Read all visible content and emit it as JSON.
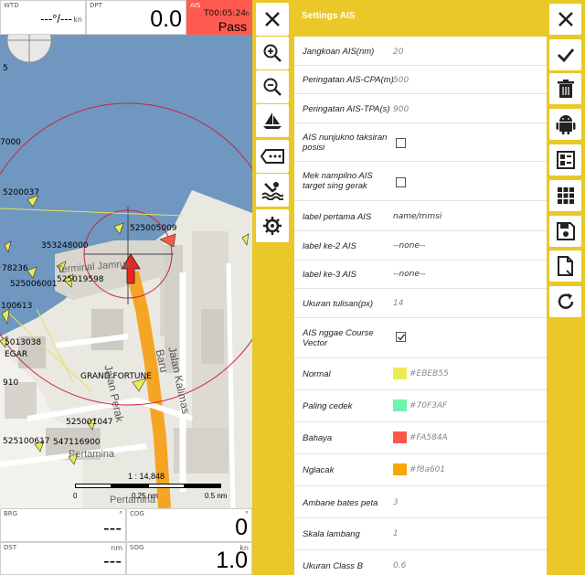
{
  "left": {
    "top_boxes": {
      "wtd": {
        "label": "WTD",
        "value": "---°/---",
        "unit": "kn"
      },
      "dpt": {
        "label": "DPT",
        "value": "0.0"
      },
      "ais": {
        "label": "AIS",
        "time": "T00:05:24",
        "time_unit": "h",
        "status": "Pass",
        "bg": "#ff5a4f"
      }
    },
    "bottom_boxes": {
      "brg": {
        "label": "BRG",
        "value": "---",
        "unit": "°"
      },
      "cog": {
        "label": "COG",
        "value": "0",
        "unit": "°"
      },
      "dst": {
        "label": "DST",
        "value": "---",
        "unit": "nm"
      },
      "sog": {
        "label": "SOG",
        "value": "1.0",
        "unit": "kn"
      }
    },
    "map": {
      "ship_labels": [
        "5",
        "7000",
        "5200037",
        "525005009",
        "353248000",
        "78236",
        "525006001",
        "525019598",
        "100613",
        "5013038",
        "EGAR",
        "910",
        "GRAND FORTUNE",
        "525001047",
        "525100617",
        "547116900"
      ],
      "place_labels": [
        "Terminal Jamrud",
        "Jalan Perak",
        "Jalan Kalimas Baru",
        "Pertamina",
        "Pertamina"
      ],
      "scale": {
        "ratio": "1 : 14,848",
        "ticks": [
          "0",
          "0.25 nm",
          "0.5 nm"
        ]
      }
    },
    "toolbar": [
      "close-icon",
      "zoom-in-icon",
      "zoom-out-icon",
      "sailboat-icon",
      "ais-tag-icon",
      "man-overboard-icon",
      "settings-icon"
    ],
    "accent": "#e9c827"
  },
  "settings": {
    "title": "Settings AIS",
    "rows": [
      {
        "label": "Jangkoan AIS(nm)",
        "value": "20"
      },
      {
        "label": "Peringatan AIS-CPA(m)",
        "value": "500"
      },
      {
        "label": "Peringatan AIS-TPA(s)",
        "value": "900"
      },
      {
        "label": "AIS nunjukno taksiran posisi",
        "checked": false
      },
      {
        "label": "Mek nampilno AIS target sing gerak",
        "checked": false
      },
      {
        "label": "label pertama AIS",
        "value": "name/mmsi"
      },
      {
        "label": "label ke-2 AIS",
        "value": "--none--"
      },
      {
        "label": "label ke-3 AIS",
        "value": "--none--"
      },
      {
        "label": "Ukuran tulisan(px)",
        "value": "14"
      },
      {
        "label": "AIS nggae Course Vector",
        "checked": true
      },
      {
        "label": "Normal",
        "color": "#EBEB55"
      },
      {
        "label": "Paling cedek",
        "color": "#70F3AF"
      },
      {
        "label": "Bahaya",
        "color": "#FA584A"
      },
      {
        "label": "Nglacak",
        "color": "#f8a601"
      },
      {
        "label": "Ambane bates peta",
        "value": "3"
      },
      {
        "label": "Skala lambang",
        "value": "1"
      },
      {
        "label": "Ukuran Class B",
        "value": "0.6"
      }
    ],
    "toolbar": [
      "close-icon",
      "check-icon",
      "trash-icon",
      "android-icon",
      "dashboard-icon",
      "grid-icon",
      "save-icon",
      "export-icon",
      "refresh-icon"
    ]
  }
}
